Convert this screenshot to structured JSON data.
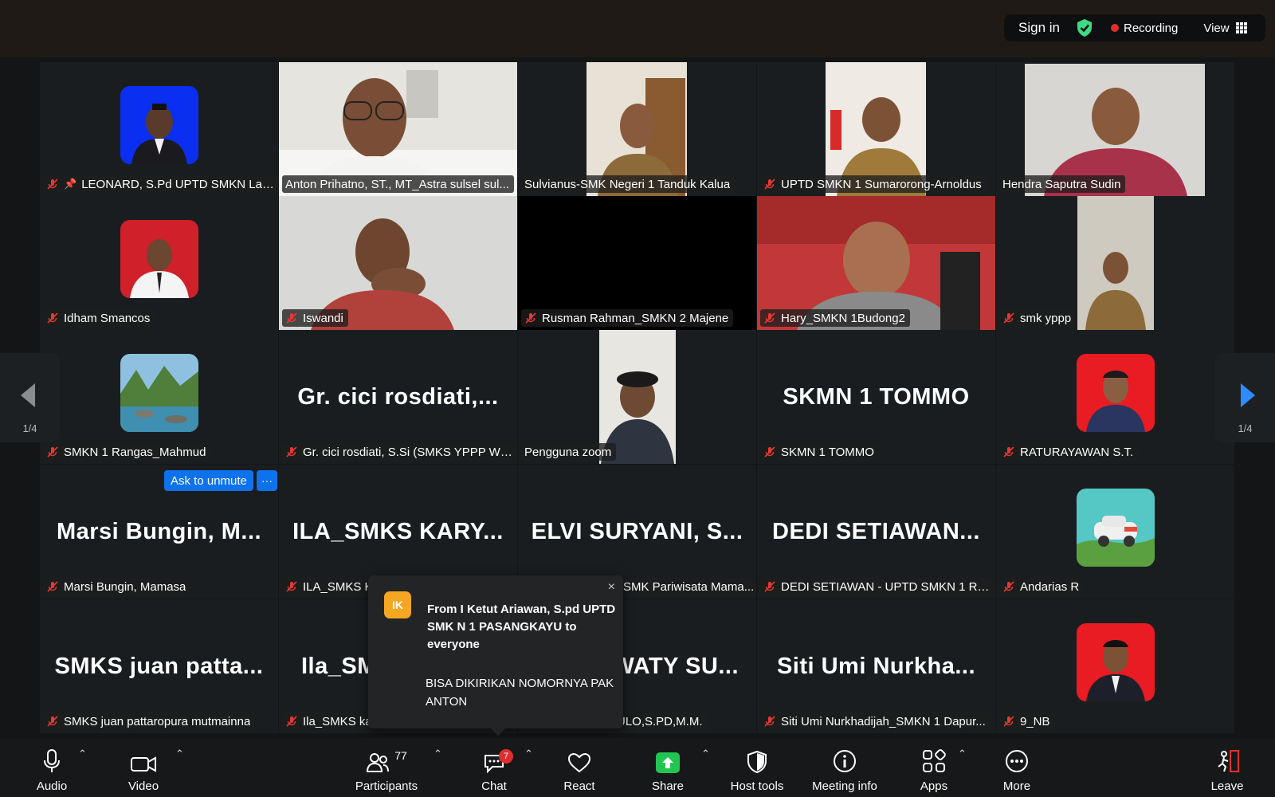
{
  "topbar": {
    "sign_in": "Sign in",
    "recording": "Recording",
    "view": "View",
    "shield_color": "#3ddc84",
    "record_color": "#e02e2e"
  },
  "tiles": [
    {
      "name": "LEONARD, S.Pd UPTD SMKN Lam...",
      "pinned": true,
      "muted": true,
      "kind": "avatar",
      "avatar": "blue-portrait"
    },
    {
      "name": "Anton Prihatno, ST., MT_Astra sulsel sul...",
      "muted": false,
      "kind": "video"
    },
    {
      "name": "Sulvianus-SMK Negeri 1 Tanduk Kalua",
      "muted": false,
      "kind": "video"
    },
    {
      "name": "UPTD SMKN 1 Sumarorong-Arnoldus",
      "muted": true,
      "kind": "video"
    },
    {
      "name": "Hendra Saputra Sudin",
      "muted": false,
      "kind": "video",
      "active": true
    },
    {
      "name": "Idham Smancos",
      "muted": true,
      "kind": "avatar",
      "avatar": "red-portrait"
    },
    {
      "name": "Iswandi",
      "muted": true,
      "kind": "video"
    },
    {
      "name": "Rusman Rahman_SMKN 2 Majene",
      "muted": true,
      "kind": "black"
    },
    {
      "name": "Hary_SMKN 1Budong2",
      "muted": true,
      "kind": "video"
    },
    {
      "name": "smk yppp",
      "muted": true,
      "kind": "video"
    },
    {
      "name": "SMKN 1 Rangas_Mahmud",
      "muted": true,
      "kind": "avatar",
      "avatar": "landscape"
    },
    {
      "name": "Gr. cici rosdiati, S.Si (SMKS YPPP WO...",
      "big": "Gr. cici rosdiati,...",
      "muted": true,
      "kind": "text"
    },
    {
      "name": "Pengguna zoom",
      "muted": false,
      "kind": "video"
    },
    {
      "name": "SKMN 1 TOMMO",
      "big": "SKMN 1 TOMMO",
      "muted": true,
      "kind": "text"
    },
    {
      "name": "RATURAYAWAN S.T.",
      "muted": true,
      "kind": "avatar",
      "avatar": "red-portrait"
    },
    {
      "name": "Marsi Bungin, Mamasa",
      "big": "Marsi Bungin, M...",
      "muted": true,
      "kind": "text"
    },
    {
      "name": "ILA_SMKS K",
      "big": "ILA_SMKS KARY...",
      "muted": true,
      "kind": "text"
    },
    {
      "name": "SMK Pariwisata Mama...",
      "big": "ELVI SURYANI, S...",
      "muted": false,
      "kind": "text"
    },
    {
      "name": "DEDI SETIAWAN - UPTD SMKN 1 RA...",
      "big": "DEDI SETIAWAN...",
      "muted": true,
      "kind": "text"
    },
    {
      "name": "Andarias R",
      "muted": true,
      "kind": "avatar",
      "avatar": "car-cartoon"
    },
    {
      "name": "SMKS juan pattaropura mutmainna",
      "big": "SMKS juan patta...",
      "muted": true,
      "kind": "text"
    },
    {
      "name": "Ila_SMKS ka",
      "big": "Ila_SM",
      "muted": true,
      "kind": "text"
    },
    {
      "name": "ULO,S.PD,M.M.",
      "big": "WATY SU...",
      "muted": false,
      "kind": "text"
    },
    {
      "name": "Siti Umi Nurkhadijah_SMKN 1 Dapur...",
      "big": "Siti Umi Nurkha...",
      "muted": true,
      "kind": "text"
    },
    {
      "name": "9_NB",
      "muted": true,
      "kind": "avatar",
      "avatar": "red-portrait"
    }
  ],
  "nav": {
    "page_left": "1/4",
    "page_right": "1/4"
  },
  "ask_to_unmute": "Ask to unmute",
  "more_dots": "···",
  "chat_popup": {
    "initials": "IK",
    "from": "From I Ketut Ariawan, S.pd UPTD SMK N 1 PASANGKAYU to everyone",
    "message": "BISA DIKIRIKAN NOMORNYA PAK ANTON",
    "close": "×"
  },
  "toolbar": {
    "audio": "Audio",
    "video": "Video",
    "participants": "Participants",
    "participants_count": "77",
    "chat": "Chat",
    "chat_badge": "7",
    "react": "React",
    "share": "Share",
    "host_tools": "Host tools",
    "meeting_info": "Meeting info",
    "apps": "Apps",
    "more": "More",
    "leave": "Leave",
    "share_color": "#23c552",
    "leave_color": "#e02e2e"
  }
}
